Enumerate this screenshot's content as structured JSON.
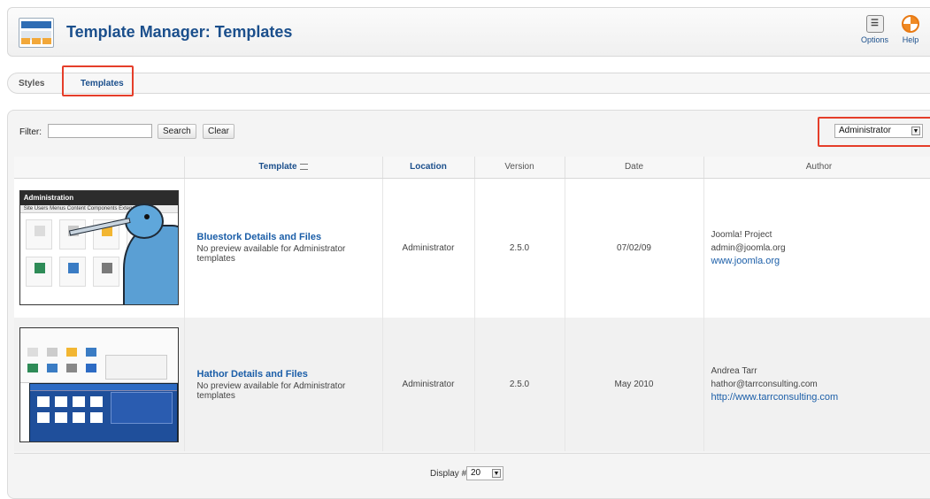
{
  "header": {
    "title": "Template Manager: Templates",
    "options_label": "Options",
    "options_icon_glyph": "☰",
    "help_label": "Help"
  },
  "tabs": [
    {
      "label": "Styles",
      "active": false
    },
    {
      "label": "Templates",
      "active": true
    }
  ],
  "filter": {
    "label": "Filter:",
    "value": "",
    "search_label": "Search",
    "clear_label": "Clear",
    "client_select": "Administrator"
  },
  "table": {
    "columns": [
      "",
      "Template",
      "Location",
      "Version",
      "Date",
      "Author"
    ],
    "rows": [
      {
        "thumbnail_title": "Administration",
        "thumbnail_menu": "Site   Users   Menus   Content   Components   Extensions",
        "name": "Bluestork Details and Files",
        "note": "No preview available for Administrator templates",
        "location": "Administrator",
        "version": "2.5.0",
        "date": "07/02/09",
        "author": "Joomla! Project",
        "email": "admin@joomla.org",
        "url": "www.joomla.org"
      },
      {
        "name": "Hathor Details and Files",
        "note": "No preview available for Administrator templates",
        "location": "Administrator",
        "version": "2.5.0",
        "date": "May 2010",
        "author": "Andrea Tarr",
        "email": "hathor@tarrconsulting.com",
        "url": "http://www.tarrconsulting.com"
      }
    ]
  },
  "pagination": {
    "display_label": "Display #",
    "display_value": "20"
  },
  "colors": {
    "accent": "#1b4f8c",
    "link": "#1b5ea8",
    "highlight": "#e53e2a"
  }
}
